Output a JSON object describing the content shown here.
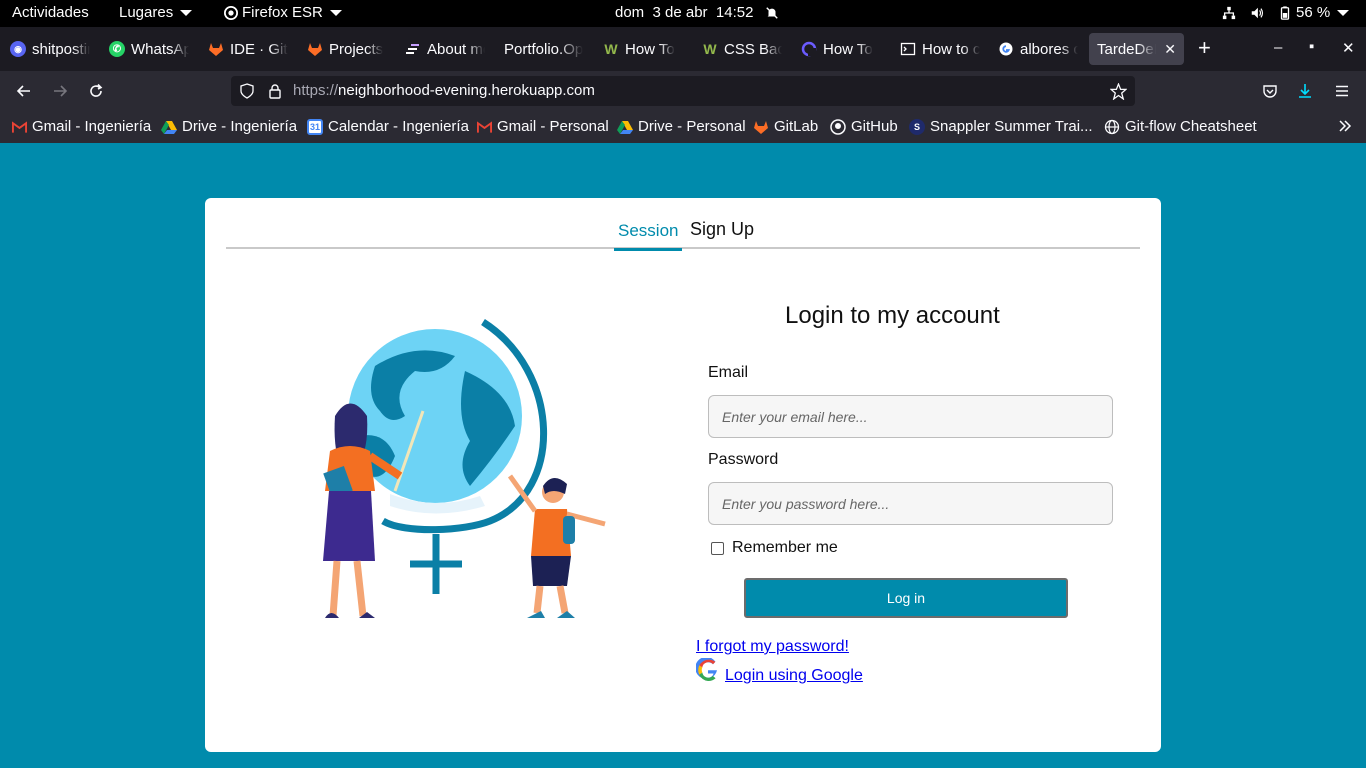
{
  "system_bar": {
    "activities": "Actividades",
    "places": "Lugares",
    "app_name": "Firefox ESR",
    "clock": "dom  3 de abr  14:52",
    "battery": "56 %"
  },
  "browser": {
    "tabs": [
      {
        "label": "shitposting",
        "favicon": "discord-icon"
      },
      {
        "label": "WhatsApp",
        "favicon": "whatsapp-icon"
      },
      {
        "label": "IDE · GitLab",
        "favicon": "gitlab-icon"
      },
      {
        "label": "Projects",
        "favicon": "gitlab-icon"
      },
      {
        "label": "About me",
        "favicon": "bars-icon"
      },
      {
        "label": "Portfolio.Op",
        "favicon": "none"
      },
      {
        "label": "How To",
        "favicon": "wikihow-icon"
      },
      {
        "label": "CSS Back",
        "favicon": "wikihow-icon"
      },
      {
        "label": "How To",
        "favicon": "swirl-icon"
      },
      {
        "label": "How to c",
        "favicon": "terminal-icon"
      },
      {
        "label": "albores c",
        "favicon": "google-icon"
      },
      {
        "label": "TardeDeE",
        "favicon": "none"
      }
    ],
    "new_tab_label": "+",
    "url_protocol": "https://",
    "url_host": "neighborhood-evening.herokuapp.com",
    "bookmarks": [
      {
        "label": "Gmail - Ingeniería",
        "icon": "gmail-icon"
      },
      {
        "label": "Drive - Ingeniería",
        "icon": "drive-icon"
      },
      {
        "label": "Calendar - Ingeniería",
        "icon": "calendar-icon"
      },
      {
        "label": "Gmail - Personal",
        "icon": "gmail-icon"
      },
      {
        "label": "Drive - Personal",
        "icon": "drive-icon"
      },
      {
        "label": "GitLab",
        "icon": "gitlab-icon"
      },
      {
        "label": "GitHub",
        "icon": "github-icon"
      },
      {
        "label": "Snappler Summer Trai...",
        "icon": "snappler-icon"
      },
      {
        "label": "Git-flow Cheatsheet",
        "icon": "globe-icon"
      }
    ]
  },
  "page": {
    "tabs": {
      "session": "Session",
      "signup": "Sign Up"
    },
    "title": "Login to my account",
    "email_label": "Email",
    "email_placeholder": "Enter your email here...",
    "password_label": "Password",
    "password_placeholder": "Enter you password here...",
    "remember_label": "Remember me",
    "login_button": "Log in",
    "forgot_link": "I forgot my password!",
    "google_link": "Login using Google"
  },
  "colors": {
    "accent": "#008bac",
    "card": "#ffffff",
    "link": "#0000ee"
  }
}
